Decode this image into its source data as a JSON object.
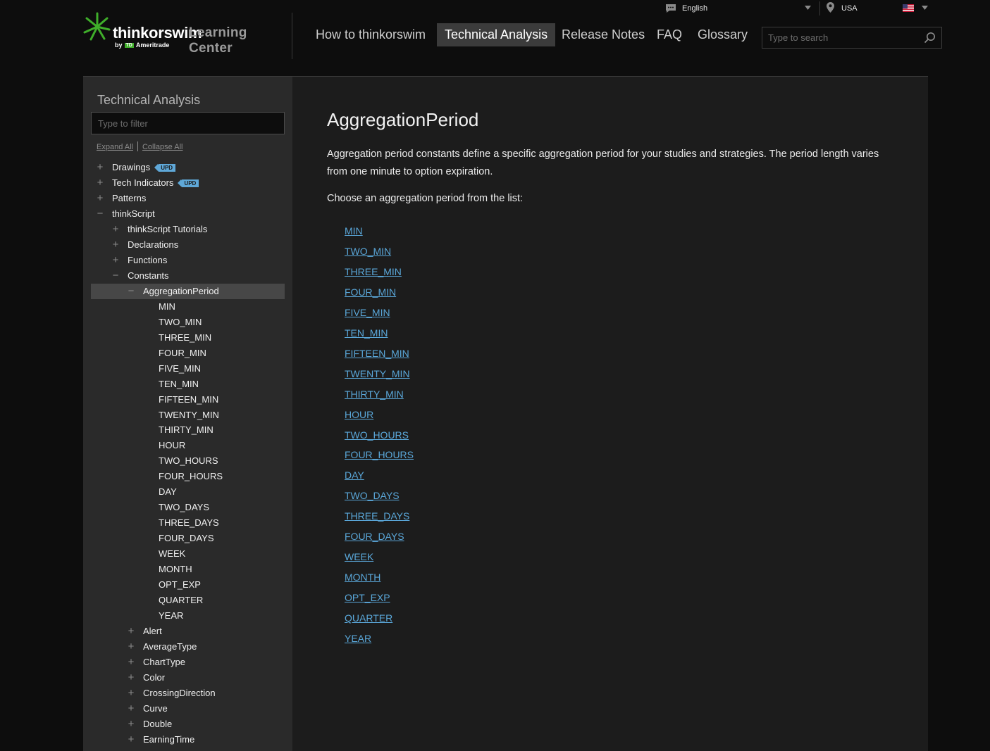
{
  "header": {
    "brand": "thinkorswim",
    "brand_sub": "Learning Center",
    "brand_by": "by",
    "brand_td": "TD",
    "brand_company": "Ameritrade",
    "language": "English",
    "region": "USA",
    "search_placeholder": "Type to search",
    "nav": [
      {
        "label": "How to thinkorswim",
        "active": false
      },
      {
        "label": "Technical Analysis",
        "active": true
      },
      {
        "label": "Release Notes",
        "active": false
      },
      {
        "label": "FAQ",
        "active": false
      },
      {
        "label": "Glossary",
        "active": false
      }
    ]
  },
  "sidebar": {
    "title": "Technical Analysis",
    "filter_placeholder": "Type to filter",
    "expand_all": "Expand All",
    "collapse_all": "Collapse All",
    "badge": "UPD",
    "tree": [
      {
        "label": "Drawings",
        "toggle": "+",
        "badge": true
      },
      {
        "label": "Tech Indicators",
        "toggle": "+",
        "badge": true
      },
      {
        "label": "Patterns",
        "toggle": "+"
      },
      {
        "label": "thinkScript",
        "toggle": "−"
      },
      {
        "label": "thinkScript Tutorials",
        "toggle": "+"
      },
      {
        "label": "Declarations",
        "toggle": "+"
      },
      {
        "label": "Functions",
        "toggle": "+"
      },
      {
        "label": "Constants",
        "toggle": "−"
      },
      {
        "label": "AggregationPeriod",
        "toggle": "−",
        "selected": true
      },
      {
        "label": "MIN"
      },
      {
        "label": "TWO_MIN"
      },
      {
        "label": "THREE_MIN"
      },
      {
        "label": "FOUR_MIN"
      },
      {
        "label": "FIVE_MIN"
      },
      {
        "label": "TEN_MIN"
      },
      {
        "label": "FIFTEEN_MIN"
      },
      {
        "label": "TWENTY_MIN"
      },
      {
        "label": "THIRTY_MIN"
      },
      {
        "label": "HOUR"
      },
      {
        "label": "TWO_HOURS"
      },
      {
        "label": "FOUR_HOURS"
      },
      {
        "label": "DAY"
      },
      {
        "label": "TWO_DAYS"
      },
      {
        "label": "THREE_DAYS"
      },
      {
        "label": "FOUR_DAYS"
      },
      {
        "label": "WEEK"
      },
      {
        "label": "MONTH"
      },
      {
        "label": "OPT_EXP"
      },
      {
        "label": "QUARTER"
      },
      {
        "label": "YEAR"
      },
      {
        "label": "Alert",
        "toggle": "+"
      },
      {
        "label": "AverageType",
        "toggle": "+"
      },
      {
        "label": "ChartType",
        "toggle": "+"
      },
      {
        "label": "Color",
        "toggle": "+"
      },
      {
        "label": "CrossingDirection",
        "toggle": "+"
      },
      {
        "label": "Curve",
        "toggle": "+"
      },
      {
        "label": "Double",
        "toggle": "+"
      },
      {
        "label": "EarningTime",
        "toggle": "+"
      }
    ]
  },
  "main": {
    "title": "AggregationPeriod",
    "intro": "Aggregation period constants define a specific aggregation period for your studies and strategies. The period length varies from one minute to option expiration.",
    "choose": "Choose an aggregation period from the list:",
    "links": [
      "MIN",
      "TWO_MIN",
      "THREE_MIN",
      "FOUR_MIN",
      "FIVE_MIN",
      "TEN_MIN",
      "FIFTEEN_MIN",
      "TWENTY_MIN",
      "THIRTY_MIN",
      "HOUR",
      "TWO_HOURS",
      "FOUR_HOURS",
      "DAY",
      "TWO_DAYS",
      "THREE_DAYS",
      "FOUR_DAYS",
      "WEEK",
      "MONTH",
      "OPT_EXP",
      "QUARTER",
      "YEAR"
    ]
  },
  "colors": {
    "accent_green": "#3fae2a",
    "link_blue": "#5aa7d9",
    "badge_blue": "#5fa8d8"
  }
}
